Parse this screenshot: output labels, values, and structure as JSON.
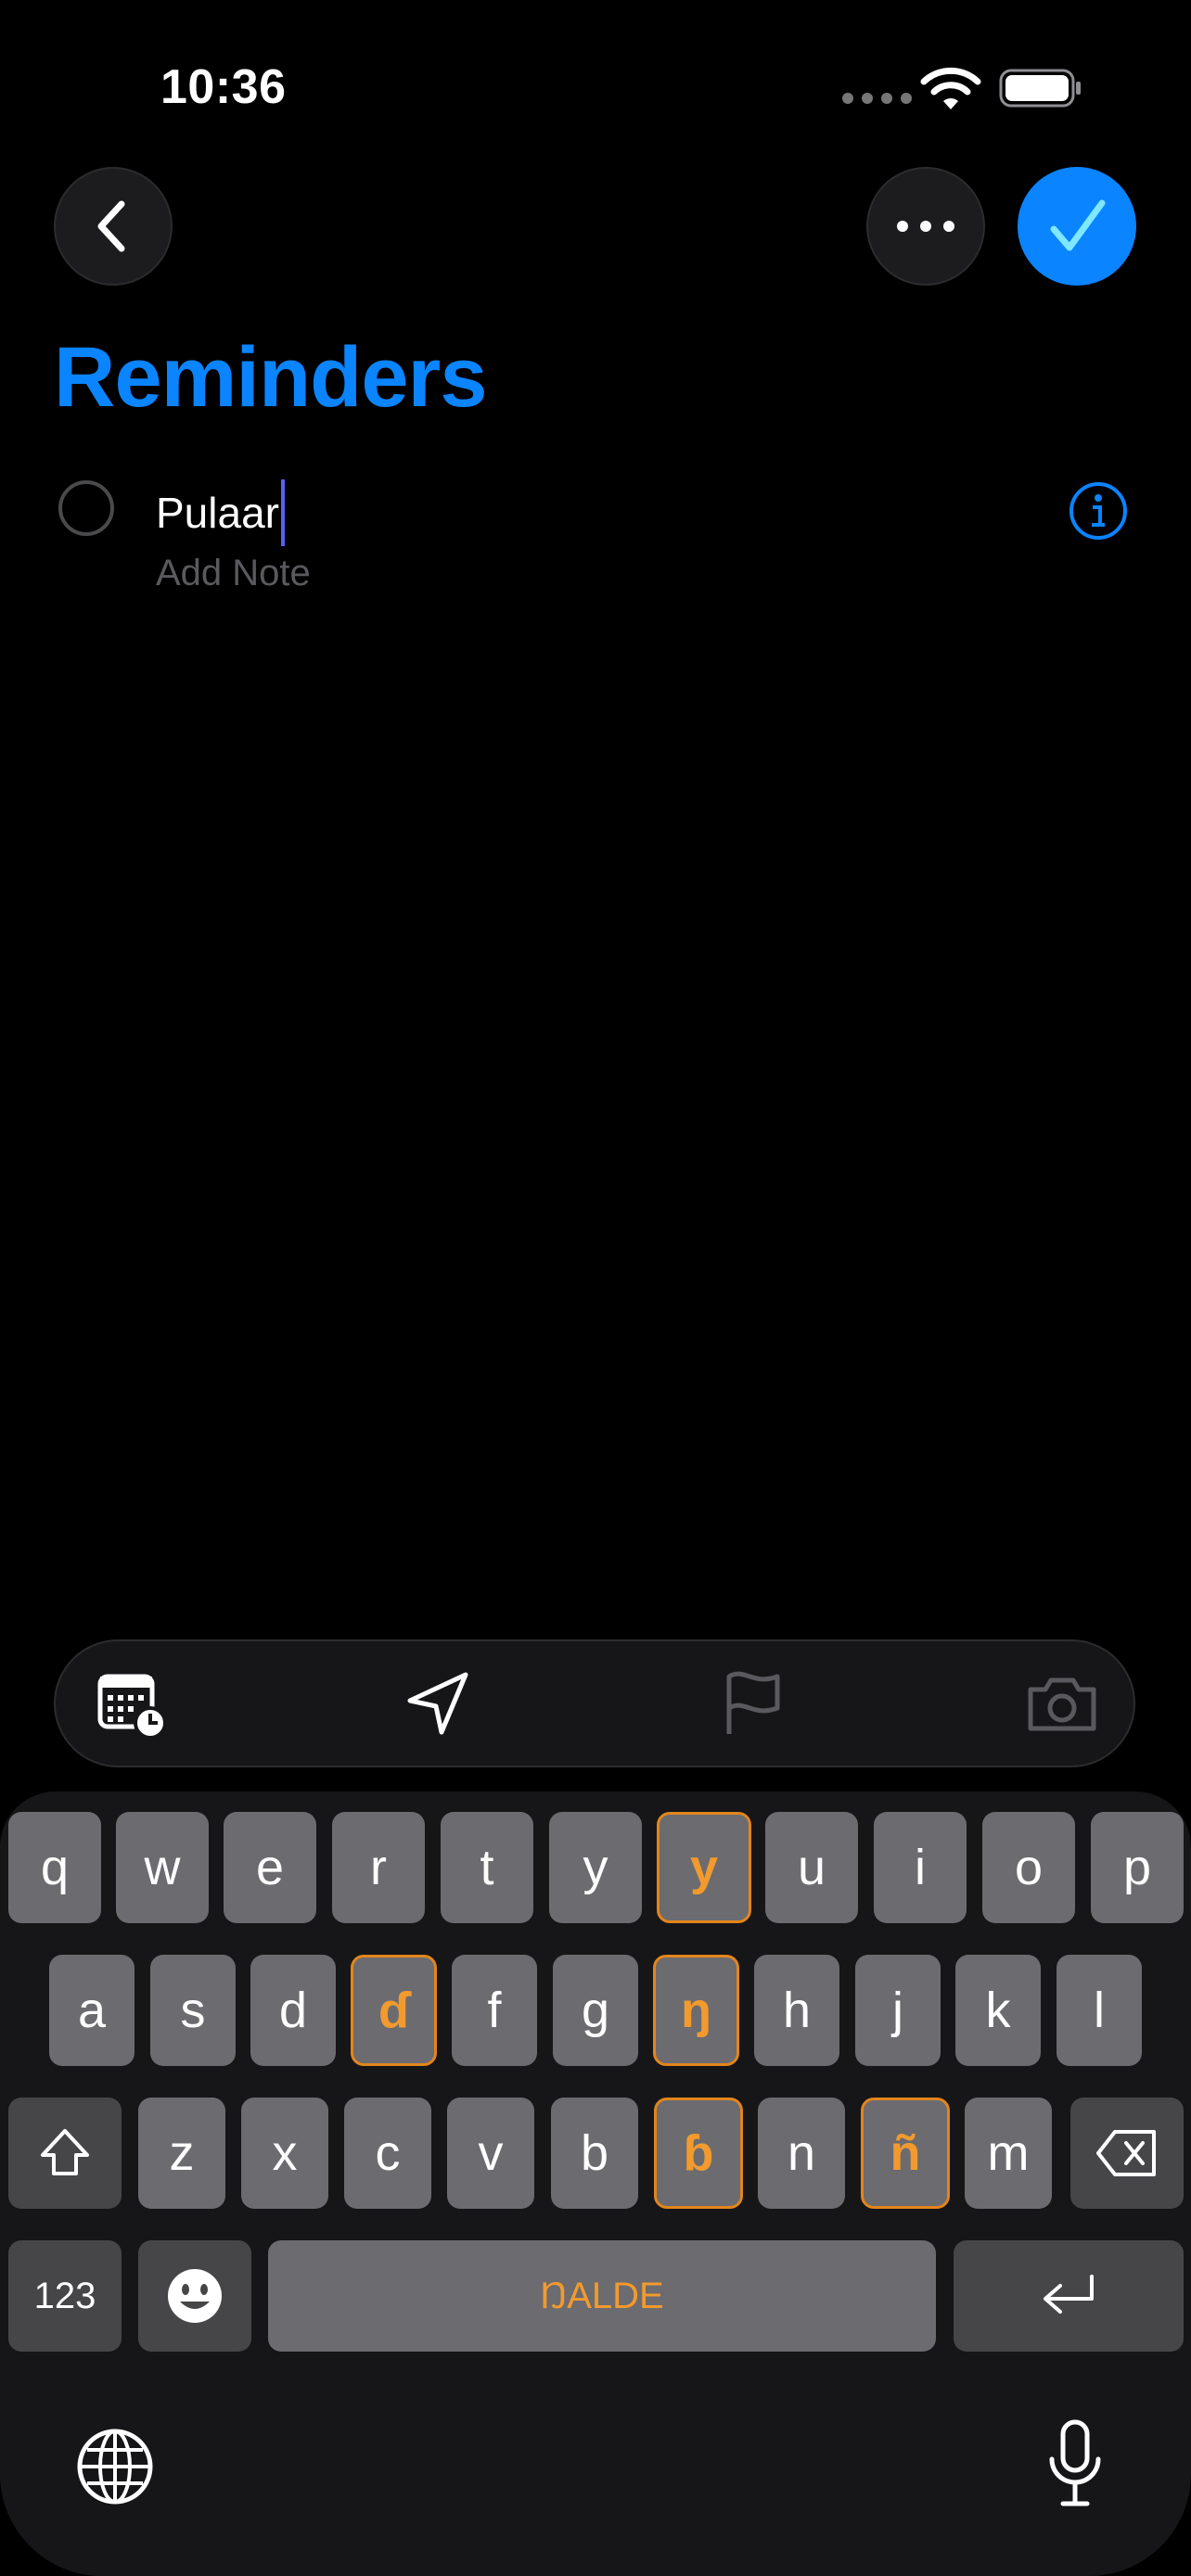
{
  "status_bar": {
    "time": "10:36"
  },
  "header": {
    "title": "Reminders"
  },
  "reminder": {
    "title": "Pulaar",
    "note_placeholder": "Add Note"
  },
  "keyboard": {
    "row1": [
      "q",
      "w",
      "e",
      "r",
      "t",
      "y",
      "y",
      "u",
      "i",
      "o",
      "p"
    ],
    "row2": [
      "a",
      "s",
      "d",
      "ɗ",
      "f",
      "g",
      "ŋ",
      "h",
      "j",
      "k",
      "l"
    ],
    "row3": [
      "z",
      "x",
      "c",
      "v",
      "b",
      "ɓ",
      "n",
      "ñ",
      "m"
    ],
    "numbers_label": "123",
    "space_label": "ŊALDE",
    "accent_color": "#f29a2e"
  },
  "colors": {
    "accent": "#0a84ff",
    "background": "#000000"
  },
  "icons": {
    "back": "chevron-left-icon",
    "more": "ellipsis-icon",
    "done": "checkmark-icon",
    "info": "info-icon",
    "date": "calendar-clock-icon",
    "location": "location-arrow-icon",
    "flag": "flag-icon",
    "camera": "camera-icon",
    "shift": "shift-icon",
    "delete": "delete-icon",
    "emoji": "emoji-icon",
    "return": "return-icon",
    "globe": "globe-icon",
    "mic": "microphone-icon"
  }
}
